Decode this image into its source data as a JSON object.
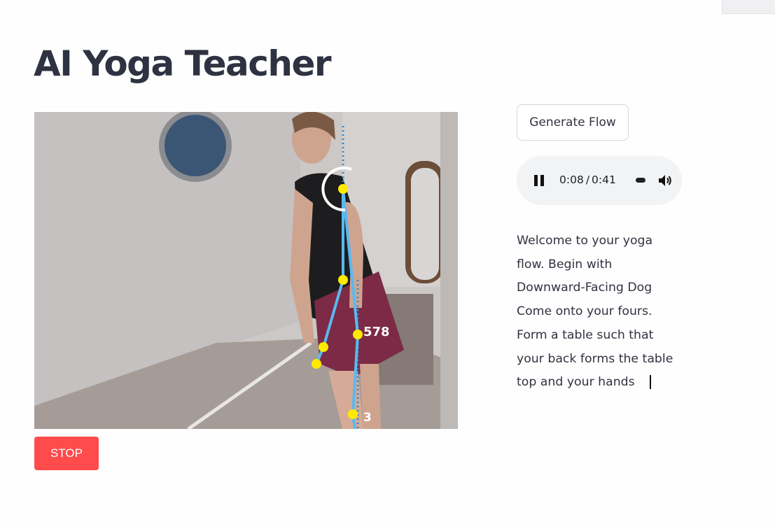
{
  "page": {
    "title": "AI Yoga Teacher"
  },
  "video": {
    "labels": {
      "hip_value": "578",
      "knee_value": "3"
    }
  },
  "controls": {
    "stop_label": "STOP",
    "generate_label": "Generate Flow"
  },
  "audio": {
    "current_time": "0:08",
    "separator": "/",
    "duration": "0:41",
    "icons": {
      "play_state": "pause-icon",
      "volume": "volume-icon"
    }
  },
  "flow": {
    "lines": [
      "Welcome to your yoga",
      "flow. Begin with",
      "Downward-Facing Dog",
      "Come onto your fours.",
      "Form a table such that",
      "your back forms the table",
      "top and your hands"
    ]
  },
  "colors": {
    "stop": "#ff4b4b",
    "skeleton": "#59b9ef",
    "joint": "#ffea00",
    "title": "#2f3241"
  }
}
